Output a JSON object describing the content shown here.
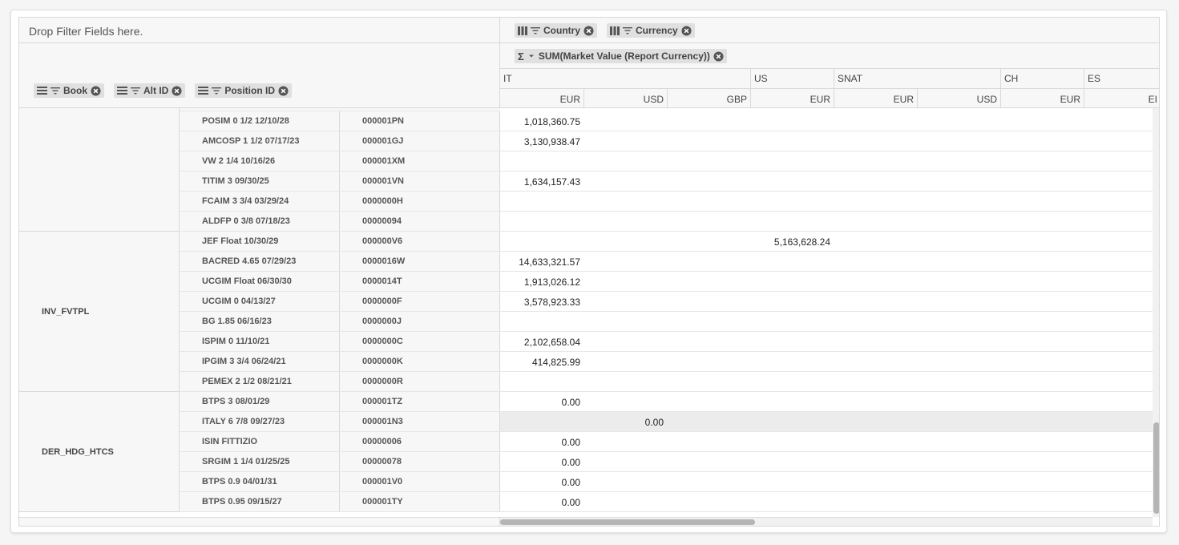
{
  "header": {
    "drop_filter_placeholder": "Drop Filter Fields here.",
    "column_fields": [
      "Country",
      "Currency"
    ],
    "value_field": "SUM(Market Value (Report Currency))",
    "row_fields": [
      "Book",
      "Alt ID",
      "Position ID"
    ]
  },
  "countries": [
    "IT",
    "US",
    "SNAT",
    "CH",
    "ES"
  ],
  "currencies": [
    "EUR",
    "USD",
    "GBP",
    "EUR",
    "EUR",
    "USD",
    "EUR",
    "EI"
  ],
  "books": [
    {
      "name": "",
      "rows": 6
    },
    {
      "name": "INV_FVTPL",
      "rows": 8
    },
    {
      "name": "DER_HDG_HTCS",
      "rows": 6
    }
  ],
  "rows": [
    {
      "alt": "POSIM 0 1/2 12/10/28",
      "pos": "000001PN",
      "vals": [
        "1,018,360.75",
        "",
        "",
        ""
      ]
    },
    {
      "alt": "AMCOSP 1 1/2 07/17/23",
      "pos": "000001GJ",
      "vals": [
        "3,130,938.47",
        "",
        "",
        ""
      ]
    },
    {
      "alt": "VW 2 1/4 10/16/26",
      "pos": "000001XM",
      "vals": [
        "",
        "",
        "",
        ""
      ]
    },
    {
      "alt": "TITIM 3 09/30/25",
      "pos": "000001VN",
      "vals": [
        "1,634,157.43",
        "",
        "",
        ""
      ]
    },
    {
      "alt": "FCAIM 3 3/4 03/29/24",
      "pos": "0000000H",
      "vals": [
        "",
        "",
        "",
        ""
      ]
    },
    {
      "alt": "ALDFP 0 3/8 07/18/23",
      "pos": "00000094",
      "vals": [
        "",
        "",
        "",
        ""
      ]
    },
    {
      "alt": "JEF Float 10/30/29",
      "pos": "000000V6",
      "vals": [
        "",
        "",
        "",
        "5,163,628.24"
      ]
    },
    {
      "alt": "BACRED 4.65 07/29/23",
      "pos": "0000016W",
      "vals": [
        "14,633,321.57",
        "",
        "",
        ""
      ]
    },
    {
      "alt": "UCGIM Float 06/30/30",
      "pos": "0000014T",
      "vals": [
        "1,913,026.12",
        "",
        "",
        ""
      ]
    },
    {
      "alt": "UCGIM 0 04/13/27",
      "pos": "0000000F",
      "vals": [
        "3,578,923.33",
        "",
        "",
        ""
      ]
    },
    {
      "alt": "BG 1.85 06/16/23",
      "pos": "0000000J",
      "vals": [
        "",
        "",
        "",
        ""
      ]
    },
    {
      "alt": "ISPIM 0 11/10/21",
      "pos": "0000000C",
      "vals": [
        "2,102,658.04",
        "",
        "",
        ""
      ]
    },
    {
      "alt": "IPGIM 3 3/4 06/24/21",
      "pos": "0000000K",
      "vals": [
        "414,825.99",
        "",
        "",
        ""
      ]
    },
    {
      "alt": "PEMEX 2 1/2 08/21/21",
      "pos": "0000000R",
      "vals": [
        "",
        "",
        "",
        ""
      ]
    },
    {
      "alt": "BTPS 3 08/01/29",
      "pos": "000001TZ",
      "vals": [
        "0.00",
        "",
        "",
        ""
      ]
    },
    {
      "alt": "ITALY 6 7/8 09/27/23",
      "pos": "000001N3",
      "vals": [
        "",
        "0.00",
        "",
        ""
      ],
      "highlight": true
    },
    {
      "alt": "ISIN FITTIZIO",
      "pos": "00000006",
      "vals": [
        "0.00",
        "",
        "",
        ""
      ]
    },
    {
      "alt": "SRGIM 1 1/4 01/25/25",
      "pos": "00000078",
      "vals": [
        "0.00",
        "",
        "",
        ""
      ]
    },
    {
      "alt": "BTPS 0.9 04/01/31",
      "pos": "000001V0",
      "vals": [
        "0.00",
        "",
        "",
        ""
      ]
    },
    {
      "alt": "BTPS 0.95 09/15/27",
      "pos": "000001TY",
      "vals": [
        "0.00",
        "",
        "",
        ""
      ]
    }
  ]
}
